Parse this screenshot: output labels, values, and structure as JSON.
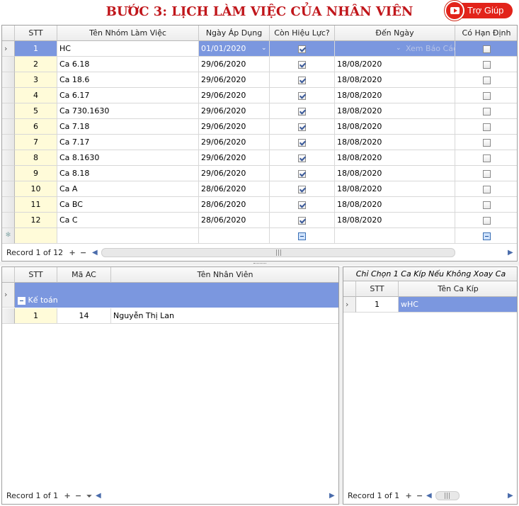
{
  "header": {
    "title": "BƯỚC 3: LỊCH LÀM VIỆC CỦA NHÂN VIÊN",
    "help_label": "Trợ Giúp"
  },
  "top_grid": {
    "columns": [
      "STT",
      "Tên Nhóm Làm Việc",
      "Ngày Áp Dụng",
      "Còn Hiệu Lực?",
      "Đến Ngày",
      "Có Hạn Định"
    ],
    "rows": [
      {
        "stt": "1",
        "name": "HC",
        "start": "01/01/2020",
        "active": true,
        "end": "",
        "end_hint": "Xem Báo Cáo",
        "limited": false
      },
      {
        "stt": "2",
        "name": "Ca 6.18",
        "start": "29/06/2020",
        "active": true,
        "end": "18/08/2020",
        "limited": false
      },
      {
        "stt": "3",
        "name": "Ca 18.6",
        "start": "29/06/2020",
        "active": true,
        "end": "18/08/2020",
        "limited": false
      },
      {
        "stt": "4",
        "name": "Ca 6.17",
        "start": "29/06/2020",
        "active": true,
        "end": "18/08/2020",
        "limited": false
      },
      {
        "stt": "5",
        "name": "Ca 730.1630",
        "start": "29/06/2020",
        "active": true,
        "end": "18/08/2020",
        "limited": false
      },
      {
        "stt": "6",
        "name": "Ca 7.18",
        "start": "29/06/2020",
        "active": true,
        "end": "18/08/2020",
        "limited": false
      },
      {
        "stt": "7",
        "name": "Ca 7.17",
        "start": "29/06/2020",
        "active": true,
        "end": "18/08/2020",
        "limited": false
      },
      {
        "stt": "8",
        "name": "Ca 8.1630",
        "start": "29/06/2020",
        "active": true,
        "end": "18/08/2020",
        "limited": false
      },
      {
        "stt": "9",
        "name": "Ca 8.18",
        "start": "29/06/2020",
        "active": true,
        "end": "18/08/2020",
        "limited": false
      },
      {
        "stt": "10",
        "name": "Ca A",
        "start": "28/06/2020",
        "active": true,
        "end": "18/08/2020",
        "limited": false
      },
      {
        "stt": "11",
        "name": "Ca BC",
        "start": "28/06/2020",
        "active": true,
        "end": "18/08/2020",
        "limited": false
      },
      {
        "stt": "12",
        "name": "Ca C",
        "start": "28/06/2020",
        "active": true,
        "end": "18/08/2020",
        "limited": false
      }
    ],
    "record_label": "Record 1 of 12"
  },
  "employee_grid": {
    "columns": [
      "STT",
      "Mã AC",
      "Tên Nhân Viên"
    ],
    "group_label": "Kế toán",
    "rows": [
      {
        "stt": "1",
        "code": "14",
        "name": "Nguyễn Thị Lan"
      }
    ],
    "record_label": "Record 1 of 1"
  },
  "shift_grid": {
    "caption": "Chỉ Chọn 1 Ca Kíp Nếu Không Xoay Ca",
    "columns": [
      "STT",
      "Tên Ca Kíp"
    ],
    "rows": [
      {
        "stt": "1",
        "name": "wHC"
      }
    ],
    "record_label": "Record 1 of 1"
  },
  "colors": {
    "accent": "#7b97df",
    "title": "#c0161b",
    "help": "#e2231a",
    "stt_bg": "#fffbd9"
  },
  "icons": [
    "youtube-icon",
    "row-indicator-icon",
    "new-row-icon",
    "sort-icon",
    "dropdown-icon",
    "collapse-group-icon",
    "add-icon",
    "remove-icon",
    "filter-icon",
    "scroll-left-icon",
    "scroll-right-icon"
  ]
}
